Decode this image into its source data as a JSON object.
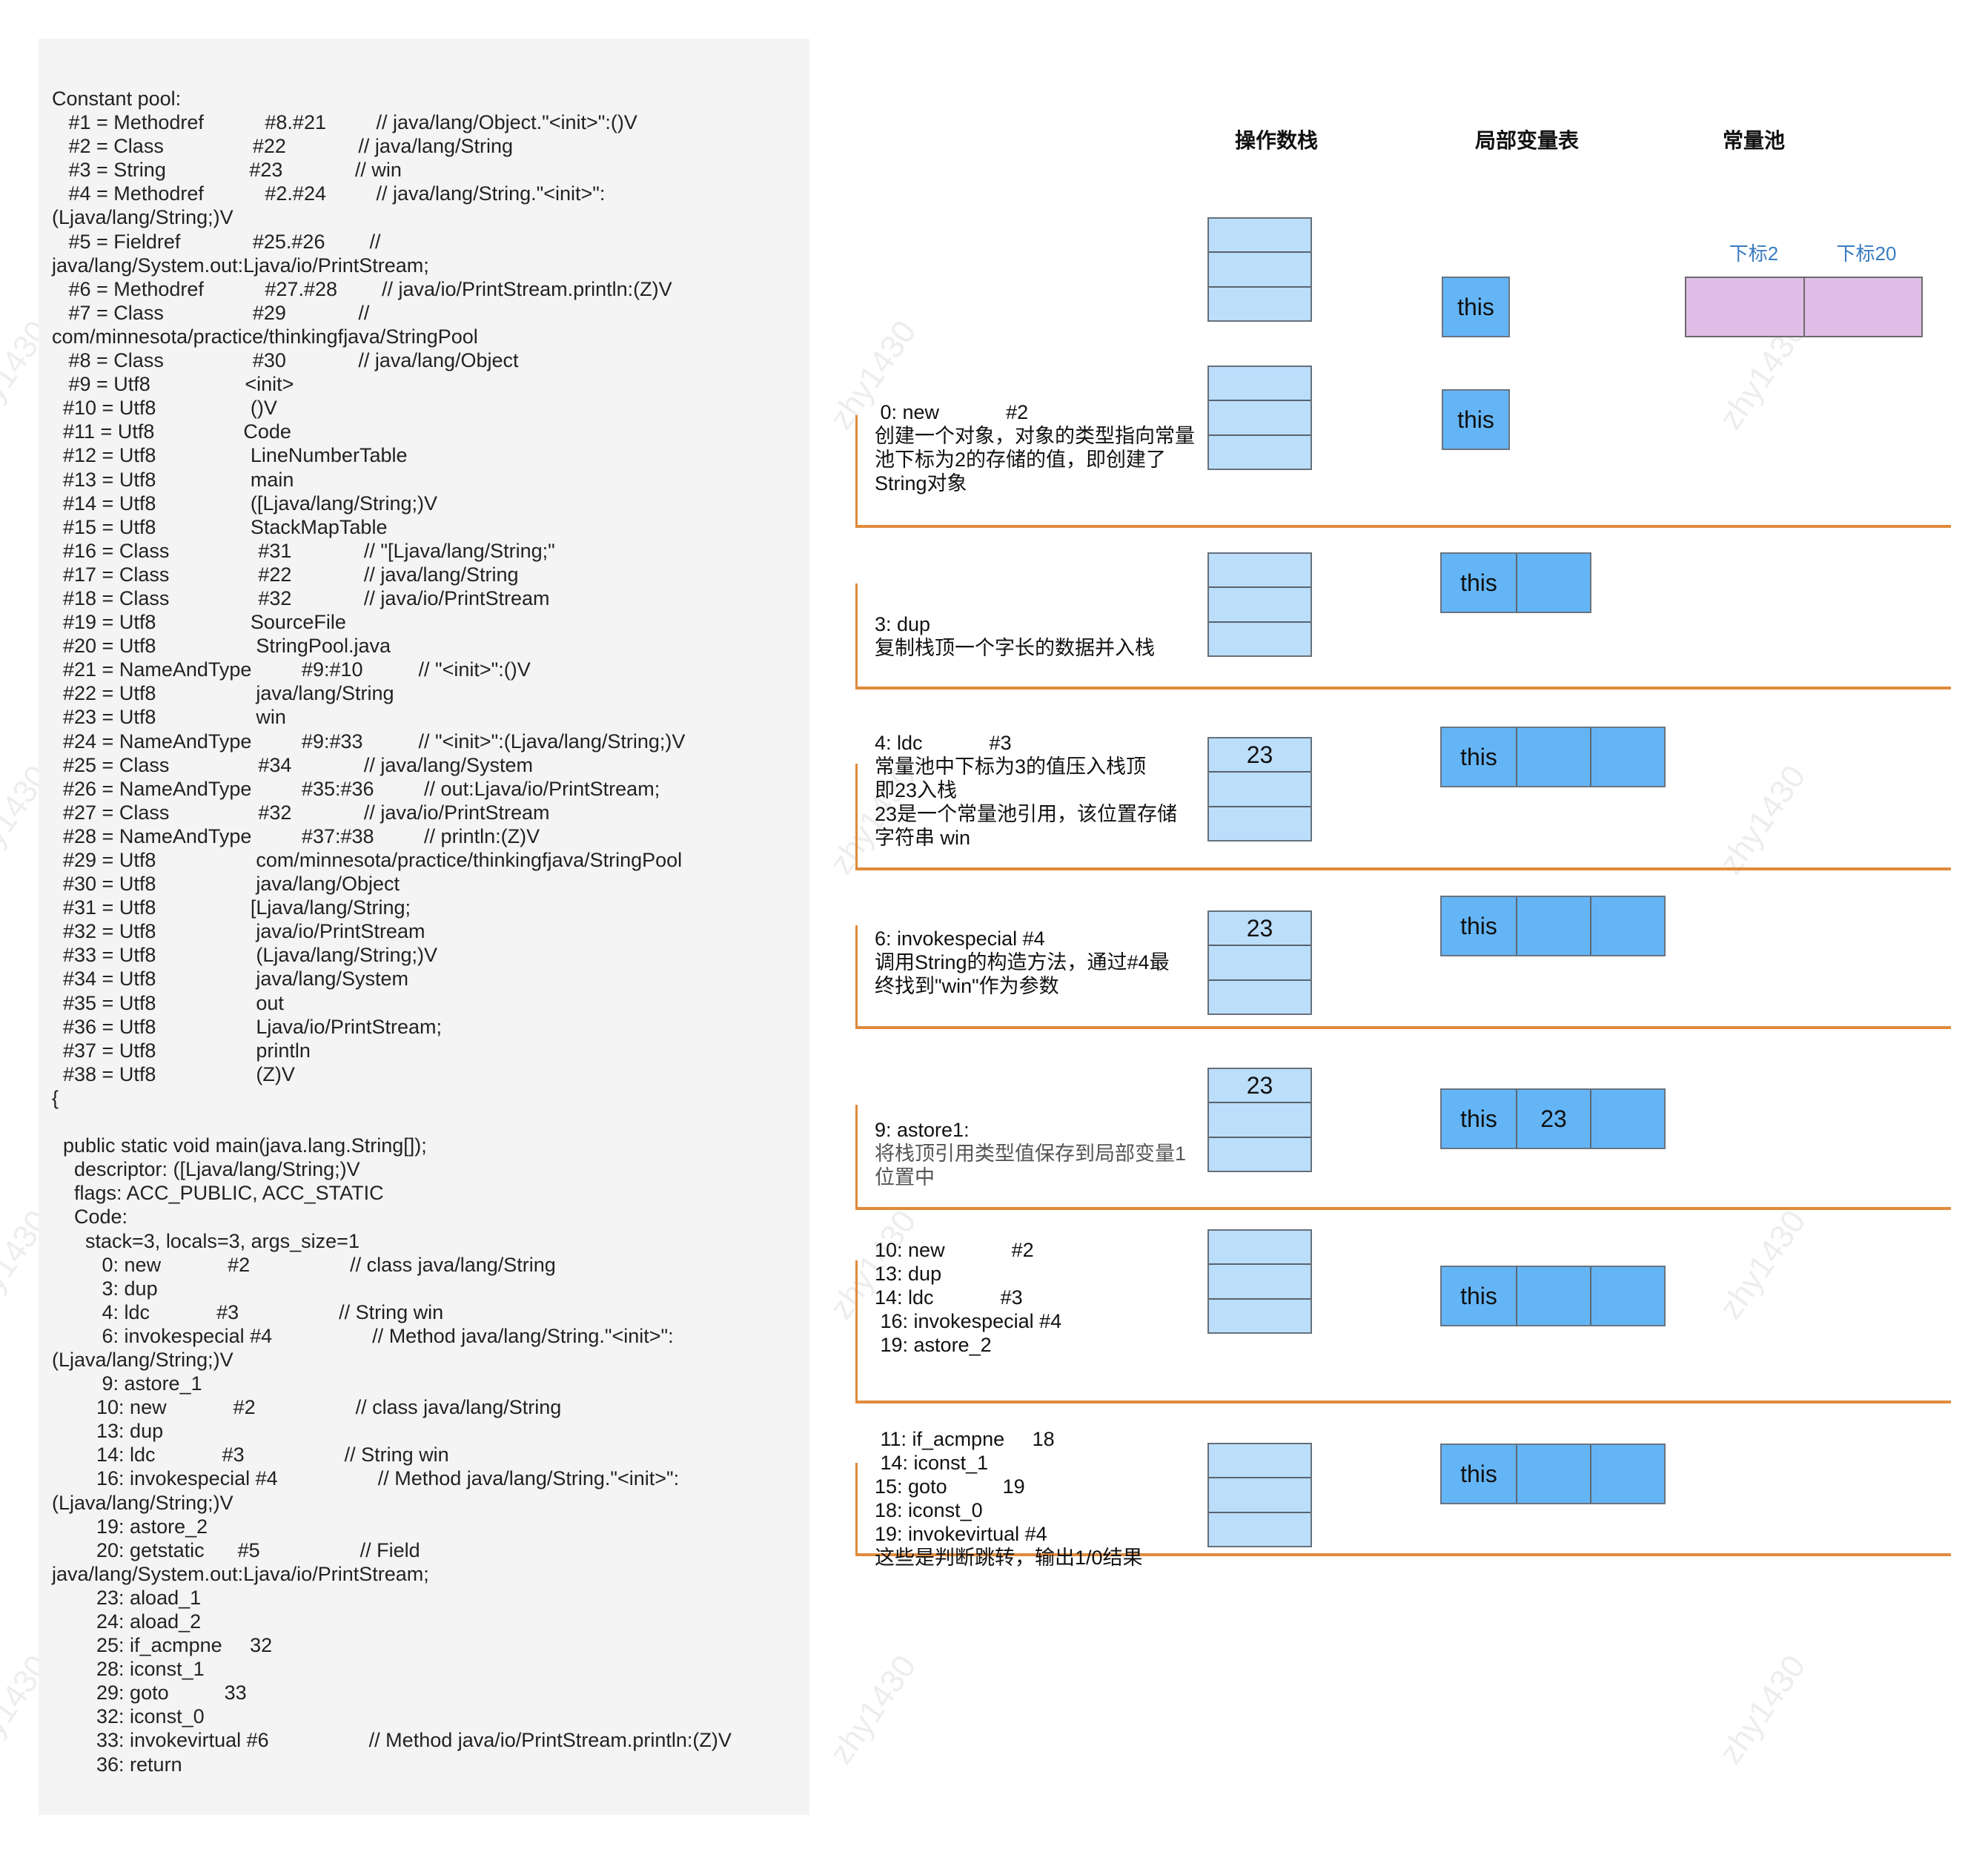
{
  "code_panel": {
    "lines": [
      "Constant pool:",
      "   #1 = Methodref           #8.#21         // java/lang/Object.\"<init>\":()V",
      "   #2 = Class                #22             // java/lang/String",
      "   #3 = String               #23             // win",
      "   #4 = Methodref           #2.#24         // java/lang/String.\"<init>\":",
      "(Ljava/lang/String;)V",
      "   #5 = Fieldref             #25.#26        //",
      "java/lang/System.out:Ljava/io/PrintStream;",
      "   #6 = Methodref           #27.#28        // java/io/PrintStream.println:(Z)V",
      "   #7 = Class                #29             //",
      "com/minnesota/practice/thinkingfjava/StringPool",
      "   #8 = Class                #30             // java/lang/Object",
      "   #9 = Utf8                 <init>",
      "  #10 = Utf8                 ()V",
      "  #11 = Utf8                Code",
      "  #12 = Utf8                 LineNumberTable",
      "  #13 = Utf8                 main",
      "  #14 = Utf8                 ([Ljava/lang/String;)V",
      "  #15 = Utf8                 StackMapTable",
      "  #16 = Class                #31             // \"[Ljava/lang/String;\"",
      "  #17 = Class                #22             // java/lang/String",
      "  #18 = Class                #32             // java/io/PrintStream",
      "  #19 = Utf8                 SourceFile",
      "  #20 = Utf8                  StringPool.java",
      "  #21 = NameAndType         #9:#10          // \"<init>\":()V",
      "  #22 = Utf8                  java/lang/String",
      "  #23 = Utf8                  win",
      "  #24 = NameAndType         #9:#33          // \"<init>\":(Ljava/lang/String;)V",
      "  #25 = Class                #34             // java/lang/System",
      "  #26 = NameAndType         #35:#36         // out:Ljava/io/PrintStream;",
      "  #27 = Class                #32             // java/io/PrintStream",
      "  #28 = NameAndType         #37:#38         // println:(Z)V",
      "  #29 = Utf8                  com/minnesota/practice/thinkingfjava/StringPool",
      "  #30 = Utf8                  java/lang/Object",
      "  #31 = Utf8                 [Ljava/lang/String;",
      "  #32 = Utf8                  java/io/PrintStream",
      "  #33 = Utf8                  (Ljava/lang/String;)V",
      "  #34 = Utf8                  java/lang/System",
      "  #35 = Utf8                  out",
      "  #36 = Utf8                  Ljava/io/PrintStream;",
      "  #37 = Utf8                  println",
      "  #38 = Utf8                  (Z)V",
      "{",
      "",
      "  public static void main(java.lang.String[]);",
      "    descriptor: ([Ljava/lang/String;)V",
      "    flags: ACC_PUBLIC, ACC_STATIC",
      "    Code:",
      "      stack=3, locals=3, args_size=1",
      "         0: new            #2                  // class java/lang/String",
      "         3: dup",
      "         4: ldc            #3                  // String win",
      "         6: invokespecial #4                  // Method java/lang/String.\"<init>\":",
      "(Ljava/lang/String;)V",
      "         9: astore_1",
      "        10: new            #2                  // class java/lang/String",
      "        13: dup",
      "        14: ldc            #3                  // String win",
      "        16: invokespecial #4                  // Method java/lang/String.\"<init>\":",
      "(Ljava/lang/String;)V",
      "        19: astore_2",
      "        20: getstatic      #5                  // Field",
      "java/lang/System.out:Ljava/io/PrintStream;",
      "        23: aload_1",
      "        24: aload_2",
      "        25: if_acmpne     32",
      "        28: iconst_1",
      "        29: goto          33",
      "        32: iconst_0",
      "        33: invokevirtual #6                  // Method java/io/PrintStream.println:(Z)V",
      "        36: return"
    ]
  },
  "diagram": {
    "headers": {
      "operand_stack": "操作数栈",
      "local_variables": "局部变量表",
      "constant_pool": "常量池"
    },
    "constant_pool": {
      "labels": [
        "下标2",
        "下标20"
      ],
      "cells": [
        "",
        ""
      ]
    },
    "initial": {
      "stack": [
        "",
        "",
        ""
      ],
      "locals": [
        "this"
      ]
    },
    "steps": [
      {
        "op_lines": [
          " 0: new            #2"
        ],
        "desc_lines": [
          "创建一个对象，对象的类型指向常量",
          "池下标为2的存储的值，即创建了",
          "String对象"
        ],
        "desc_gray": false,
        "stack": [
          "",
          "",
          ""
        ],
        "locals": [
          "this"
        ]
      },
      {
        "op_lines": [
          "3: dup"
        ],
        "desc_lines": [
          "复制栈顶一个字长的数据并入栈"
        ],
        "desc_gray": false,
        "stack": [
          "",
          "",
          ""
        ],
        "locals": [
          "this",
          ""
        ]
      },
      {
        "op_lines": [
          "4: ldc            #3"
        ],
        "desc_lines": [
          "常量池中下标为3的值压入栈顶",
          "即23入栈",
          "23是一个常量池引用，该位置存储",
          "字符串 win"
        ],
        "desc_gray": false,
        "stack": [
          "23",
          "",
          ""
        ],
        "locals": [
          "this",
          "",
          ""
        ]
      },
      {
        "op_lines": [
          "6: invokespecial #4"
        ],
        "desc_lines": [
          "调用String的构造方法，通过#4最",
          "终找到\"win\"作为参数"
        ],
        "desc_gray": false,
        "stack": [
          "23",
          "",
          ""
        ],
        "locals": [
          "this",
          "",
          ""
        ]
      },
      {
        "op_lines": [
          "9: astore1:"
        ],
        "desc_lines": [
          "将栈顶引用类型值保存到局部变量1",
          "位置中"
        ],
        "desc_gray": true,
        "stack": [
          "23",
          "",
          ""
        ],
        "locals": [
          "this",
          "23",
          ""
        ]
      },
      {
        "op_lines": [
          "10: new            #2",
          "13: dup",
          "14: ldc            #3",
          " 16: invokespecial #4",
          " 19: astore_2"
        ],
        "desc_lines": [],
        "desc_gray": false,
        "stack": [
          "",
          "",
          ""
        ],
        "locals": [
          "this",
          "",
          ""
        ]
      },
      {
        "op_lines": [
          " 11: if_acmpne     18",
          " 14: iconst_1",
          "15: goto          19",
          "18: iconst_0",
          "19: invokevirtual #4"
        ],
        "desc_lines": [
          "这些是判断跳转，输出1/0结果"
        ],
        "desc_gray": false,
        "stack": [
          "",
          "",
          ""
        ],
        "locals": [
          "this",
          "",
          ""
        ]
      }
    ]
  },
  "watermark": "zhy1430",
  "colors": {
    "code_bg": "#f4f4f4",
    "stack_cell": "#bbdefb",
    "locals_cell": "#64b5f6",
    "pool_cell": "#e1bee7",
    "section_line": "#e08a3c",
    "pool_label": "#3a7cc0"
  }
}
